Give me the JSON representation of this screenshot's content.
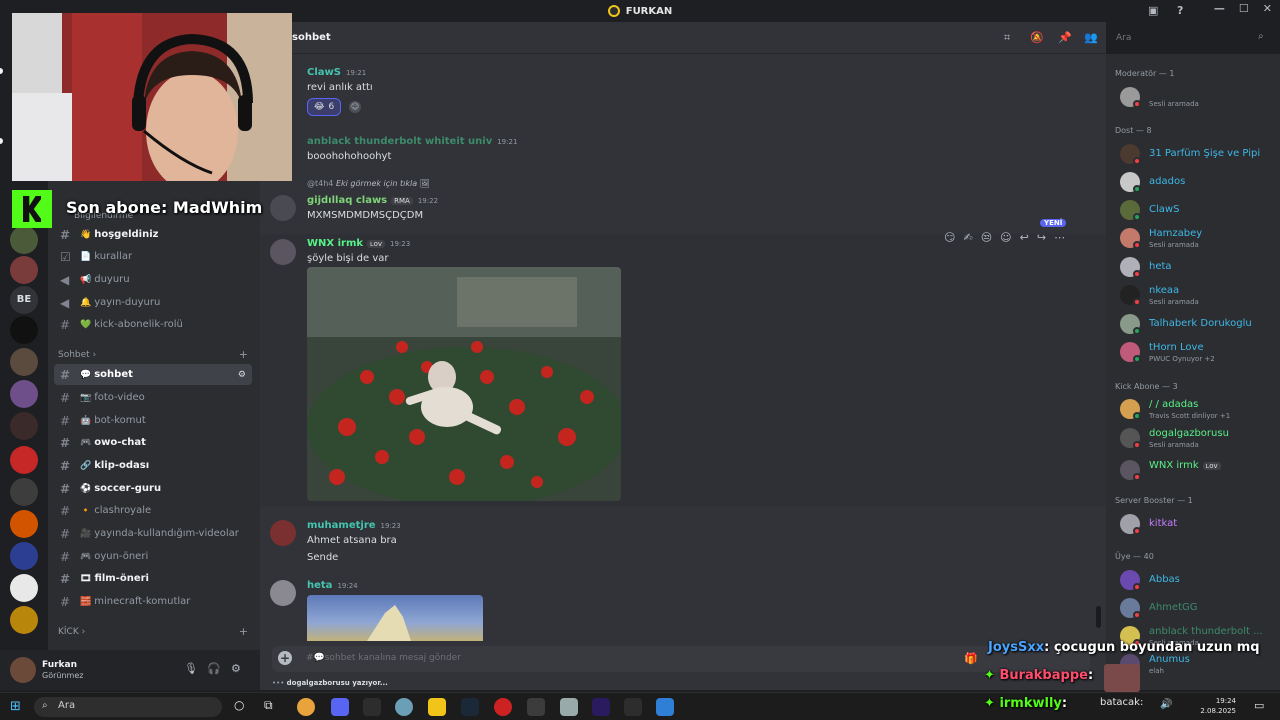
{
  "window": {
    "title": "FURKAN"
  },
  "channel_header": {
    "title": "sohbet",
    "search_placeholder": "Ara"
  },
  "sidebar": {
    "hidden_label": "Bilgilendirme",
    "categories": {
      "sohbet": "Sohbet",
      "kick": "KİCK"
    },
    "channels": [
      {
        "name": "hoşgeldiniz",
        "emoji": "👋"
      },
      {
        "name": "kurallar",
        "emoji": "📄"
      },
      {
        "name": "duyuru",
        "emoji": "📢"
      },
      {
        "name": "yayın-duyuru",
        "emoji": "🔔"
      },
      {
        "name": "kick-abonelik-rolü",
        "emoji": "💚"
      },
      {
        "name": "sohbet",
        "emoji": "💬"
      },
      {
        "name": "foto-video",
        "emoji": "📷"
      },
      {
        "name": "bot-komut",
        "emoji": "🤖"
      },
      {
        "name": "owo-chat",
        "emoji": "🎮"
      },
      {
        "name": "klip-odası",
        "emoji": "🔗"
      },
      {
        "name": "soccer-guru",
        "emoji": "⚽"
      },
      {
        "name": "clashroyale",
        "emoji": "🔸"
      },
      {
        "name": "yayında-kullandığım-videolar",
        "emoji": "🎥"
      },
      {
        "name": "oyun-öneri",
        "emoji": "🎮"
      },
      {
        "name": "film-öneri",
        "emoji": "🎞"
      },
      {
        "name": "minecraft-komutlar",
        "emoji": "🧱"
      }
    ]
  },
  "user_panel": {
    "name": "Furkan",
    "status": "Görünmez"
  },
  "messages": [
    {
      "author": "ClawS",
      "time": "19:21",
      "text": "revi anlık attı",
      "reaction_count": "6"
    },
    {
      "author": "anblack thunderbolt whiteit univ",
      "time": "19:21",
      "text": "booohohohoohyt"
    },
    {
      "reply_to": "@t4h4",
      "reply_text": "Eki görmek için tıkla",
      "author": "gijdıllaq claws",
      "tag": "RMA",
      "time": "19:22",
      "text": "MXMSMDMDMSÇDÇDM"
    },
    {
      "author": "WNX irmk",
      "tag": "ʟᴏᴠ",
      "time": "19:23",
      "text": "şöyle bişi de var",
      "new_label": "YENİ"
    },
    {
      "author": "muhametjre",
      "time": "19:23",
      "text": "Ahmet atsana bra",
      "text2": "Sende"
    },
    {
      "author": "heta",
      "time": "19:24"
    }
  ],
  "composer": {
    "placeholder": "#💬sohbet kanalına mesaj gönder",
    "typing": "dogalgazborusu yazıyor..."
  },
  "members": {
    "groups": [
      "Moderatör — 1",
      "Dost — 8",
      "Kick Abone — 3",
      "Server Booster — 1",
      "Üye — 40"
    ],
    "list": [
      {
        "name": "",
        "status": "Sesli aramada"
      },
      {
        "name": "31 Parfüm Şişe ve Pipi",
        "status": ""
      },
      {
        "name": "adados",
        "status": ""
      },
      {
        "name": "ClawS",
        "status": ""
      },
      {
        "name": "Hamzabey",
        "status": "Sesli aramada"
      },
      {
        "name": "heta",
        "status": ""
      },
      {
        "name": "nkeaa",
        "status": "Sesli aramada"
      },
      {
        "name": "Talhaberk Dorukoglu",
        "status": ""
      },
      {
        "name": "tHorn Love",
        "status": "PWUC Oynuyor +2"
      },
      {
        "name": "/ / adadas",
        "status": "Travis Scott dinliyor +1"
      },
      {
        "name": "dogalgazborusu",
        "status": "Sesli aramada"
      },
      {
        "name": "WNX irmk",
        "status": "",
        "tag": "ʟᴏᴠ"
      },
      {
        "name": "kitkat",
        "status": ""
      },
      {
        "name": "Abbas",
        "status": ""
      },
      {
        "name": "AhmetGG",
        "status": ""
      },
      {
        "name": "anblack thunderbolt ...",
        "status": "Sesli aramada"
      },
      {
        "name": "Anumus",
        "status": "elah"
      }
    ]
  },
  "stream_overlay": {
    "sub_text": "Son abone: MadWhim",
    "chat": [
      {
        "user": "JoysSxx",
        "text": ": çocugun boyundan uzun mq"
      },
      {
        "user": "Burakbappe",
        "text": ":"
      },
      {
        "user": "irmkwlly",
        "text": ":"
      }
    ],
    "partial": "batacak:",
    "ben_label": "BE"
  },
  "taskbar": {
    "search": "Ara",
    "time": "19:24",
    "date": "2.08.2025"
  },
  "colors": {
    "accent": "#5865f2",
    "kick_green": "#53fc18",
    "online": "#23a55a",
    "dnd": "#f23f43"
  }
}
